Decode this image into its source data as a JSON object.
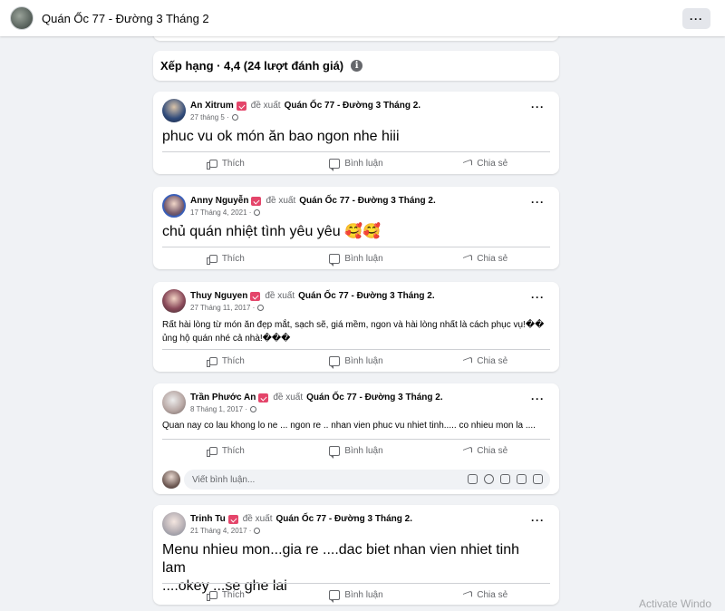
{
  "page": {
    "title": "Quán Ốc 77 - Đường 3 Tháng 2",
    "more_label": "···"
  },
  "rating": {
    "text": "Xếp hạng · 4,4 (24 lượt đánh giá)",
    "info_icon": "i"
  },
  "labels": {
    "recommends": "đề xuất",
    "like": "Thích",
    "comment": "Bình luận",
    "share": "Chia sẻ",
    "more": "···",
    "comment_placeholder": "Viết bình luận..."
  },
  "reviews": [
    {
      "author": "An Xitrum",
      "page": "Quán Ốc 77 - Đường 3 Tháng 2.",
      "date": "27 tháng 5 ·",
      "text": "phuc vu ok món ăn bao ngon nhe hiii"
    },
    {
      "author": "Anny Nguyễn",
      "page": "Quán Ốc 77 - Đường 3 Tháng 2.",
      "date": "17 Tháng 4, 2021 ·",
      "text": "chủ quán nhiệt tình yêu yêu 🥰🥰"
    },
    {
      "author": "Thuy Nguyen",
      "page": "Quán Ốc 77 - Đường 3 Tháng 2.",
      "date": "27 Tháng 11, 2017 ·",
      "text_line1": "Rất hài lòng từ món ăn đẹp mắt, sạch sẽ, giá mềm, ngon và hài lòng nhất là cách phục vụ!��",
      "text_line2": "ủng hộ quán nhé cả nhà!���"
    },
    {
      "author": "Trần Phước An",
      "page": "Quán Ốc 77 - Đường 3 Tháng 2.",
      "date": "8 Tháng 1, 2017 ·",
      "text": "Quan nay co lau khong lo ne ... ngon re .. nhan vien phuc vu nhiet tinh..... co nhieu mon la ...."
    },
    {
      "author": "Trinh Tu",
      "page": "Quán Ốc 77 - Đường 3 Tháng 2.",
      "date": "21 Tháng 4, 2017 ·",
      "text_line1": "Menu nhieu mon...gia re ....dac biet nhan vien nhiet tinh lam",
      "text_line2": "....okey ...se ghe lai"
    }
  ],
  "watermark": "Activate Windo"
}
